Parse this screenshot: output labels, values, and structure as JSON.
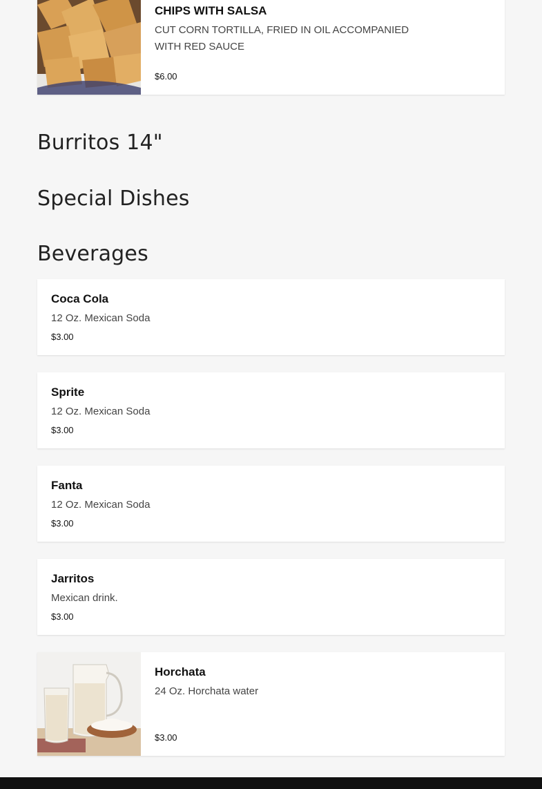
{
  "appetizers": [
    {
      "name": "CHIPS WITH SALSA",
      "description": "CUT CORN TORTILLA, FRIED IN OIL ACCOMPANIED WITH RED SAUCE",
      "price": "$6.00",
      "image": "tortilla-chips-photo"
    }
  ],
  "sections": {
    "burritos": "Burritos 14\"",
    "special": "Special Dishes",
    "beverages": "Beverages"
  },
  "beverages": [
    {
      "name": "Coca Cola",
      "description": "12 Oz. Mexican Soda",
      "price": "$3.00"
    },
    {
      "name": "Sprite",
      "description": "12 Oz. Mexican Soda",
      "price": "$3.00"
    },
    {
      "name": "Fanta",
      "description": "12 Oz. Mexican Soda",
      "price": "$3.00"
    },
    {
      "name": "Jarritos",
      "description": "Mexican drink.",
      "price": "$3.00"
    },
    {
      "name": "Horchata",
      "description": "24 Oz. Horchata water",
      "price": "$3.00",
      "image": "horchata-photo"
    }
  ],
  "colors": {
    "background": "#f6f6f6",
    "card": "#ffffff",
    "footer": "#111111"
  }
}
